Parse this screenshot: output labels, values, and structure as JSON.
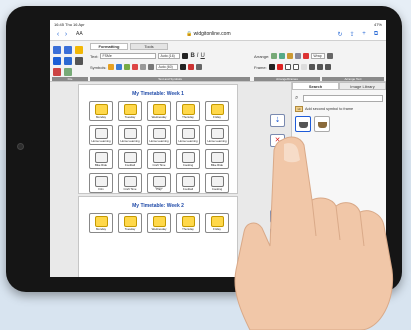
{
  "statusbar": {
    "time": "16:45 Thu 16 Apr",
    "battery": "47%"
  },
  "browser": {
    "text_size": "AA",
    "url": "widgitonline.com"
  },
  "ribbon": {
    "tabs": [
      {
        "label": "Formatting"
      },
      {
        "label": "Tools"
      }
    ],
    "text_label": "Text:",
    "font_name": "FSMe",
    "font_size": "Auto (16)",
    "bold": "B",
    "italic": "I",
    "underline": "U",
    "symbols_label": "Symbols:",
    "symbol_size": "Auto (60)",
    "arrange_label": "Arrange:",
    "frame_label": "Frame:",
    "wrap_label": "Wrap",
    "section_file": "File",
    "section_text": "Text and Symbols",
    "section_arrange": "Arrange/Frames",
    "section_align": "Arrange Text"
  },
  "document": {
    "title1": "My Timetable: Week 1",
    "title2": "My Timetable: Week 2",
    "name_placeholder": "Name",
    "rows": [
      [
        "Monday",
        "Tuesday",
        "Wednesday",
        "Thursday",
        "Friday"
      ],
      [
        "Home Learning",
        "Home Learning",
        "Home Learning",
        "Home Learning",
        "Home Learning"
      ],
      [
        "Bike Ride",
        "Football",
        "Craft Time",
        "Cooking",
        "Bike Ride"
      ],
      [
        "Film",
        "Craft Time",
        "Play",
        "Football",
        "Cooking"
      ]
    ],
    "week2_row": [
      "Monday",
      "Tuesday",
      "Wednesday",
      "Thursday",
      "Friday"
    ]
  },
  "panel": {
    "tab_search": "Search",
    "tab_library": "Image Library",
    "add_badge": "Hi",
    "add_second_symbol": "Add second symbol to frame"
  },
  "colors": {
    "accent": "#1e5bd7",
    "day_yellow": "#ffd84a",
    "title_blue": "#1f4aa8"
  }
}
